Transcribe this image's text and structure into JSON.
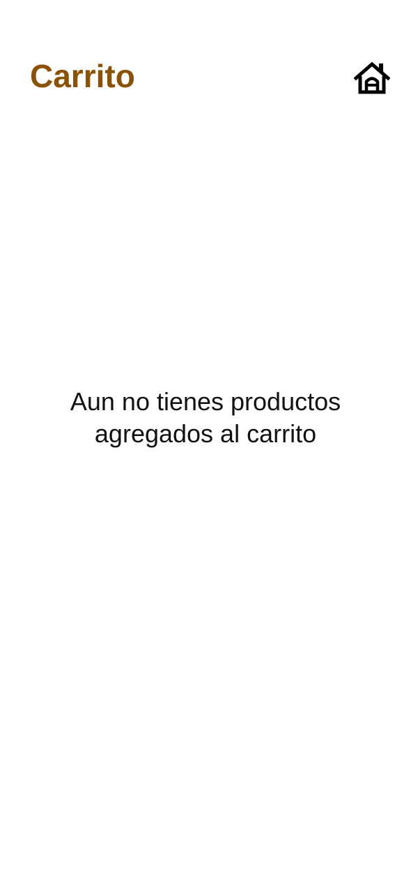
{
  "header": {
    "title": "Carrito",
    "title_color": "#8a5206",
    "home_icon": "home-icon"
  },
  "cart": {
    "empty_message_line1": "Aun no tienes productos",
    "empty_message_line2": "agregados al carrito"
  }
}
